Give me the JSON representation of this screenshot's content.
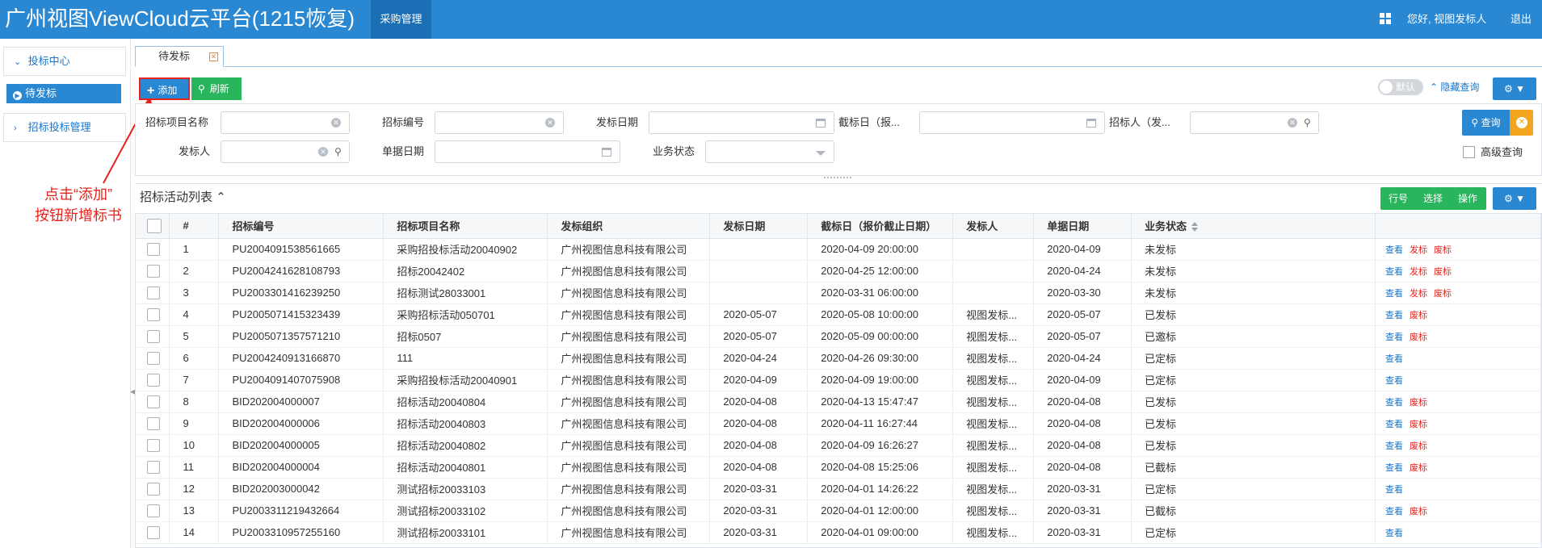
{
  "header": {
    "app_title": "广州视图ViewCloud云平台(1215恢复)",
    "module_tab": "采购管理",
    "greeting": "您好, 视图发标人",
    "logout": "退出"
  },
  "sidebar": {
    "groups": [
      {
        "label": "投标中心",
        "expanded": true
      },
      {
        "label": "招标投标管理",
        "expanded": false
      }
    ],
    "active_item": "待发标"
  },
  "annotation": {
    "line1": "点击“添加”",
    "line2": "按钮新增标书"
  },
  "tabs": [
    {
      "label": "待发标",
      "close": "✕"
    }
  ],
  "toolbar": {
    "add_label": "添加",
    "refresh_label": "刷新",
    "default_toggle": "默认",
    "hide_query": "隐藏查询"
  },
  "filters": {
    "project_name": "招标项目名称",
    "bid_no": "招标编号",
    "publish_date": "发标日期",
    "deadline": "截标日（报...",
    "bidder": "招标人（发...",
    "publisher": "发标人",
    "doc_date": "单据日期",
    "biz_status": "业务状态",
    "query_button": "查询",
    "advanced_query": "高级查询"
  },
  "list": {
    "title": "招标活动列表",
    "row_no_btn": "行号",
    "select_btn": "选择",
    "action_btn": "操作"
  },
  "table": {
    "columns": [
      "#",
      "招标编号",
      "招标项目名称",
      "发标组织",
      "发标日期",
      "截标日（报价截止日期）",
      "发标人",
      "单据日期",
      "业务状态"
    ],
    "rows": [
      {
        "no": "1",
        "code": "PU2004091538561665",
        "name": "采购招投标活动20040902",
        "org": "广州视图信息科技有限公司",
        "pub_date": "",
        "deadline": "2020-04-09 20:00:00",
        "publisher": "",
        "doc_date": "2020-04-09",
        "status": "未发标",
        "ops": [
          "查看",
          "发标",
          "废标"
        ]
      },
      {
        "no": "2",
        "code": "PU2004241628108793",
        "name": "招标20042402",
        "org": "广州视图信息科技有限公司",
        "pub_date": "",
        "deadline": "2020-04-25 12:00:00",
        "publisher": "",
        "doc_date": "2020-04-24",
        "status": "未发标",
        "ops": [
          "查看",
          "发标",
          "废标"
        ]
      },
      {
        "no": "3",
        "code": "PU2003301416239250",
        "name": "招标测试28033001",
        "org": "广州视图信息科技有限公司",
        "pub_date": "",
        "deadline": "2020-03-31 06:00:00",
        "publisher": "",
        "doc_date": "2020-03-30",
        "status": "未发标",
        "ops": [
          "查看",
          "发标",
          "废标"
        ]
      },
      {
        "no": "4",
        "code": "PU2005071415323439",
        "name": "采购招标活动050701",
        "org": "广州视图信息科技有限公司",
        "pub_date": "2020-05-07",
        "deadline": "2020-05-08 10:00:00",
        "publisher": "视图发标...",
        "doc_date": "2020-05-07",
        "status": "已发标",
        "ops": [
          "查看",
          "废标"
        ]
      },
      {
        "no": "5",
        "code": "PU2005071357571210",
        "name": "招标0507",
        "org": "广州视图信息科技有限公司",
        "pub_date": "2020-05-07",
        "deadline": "2020-05-09 00:00:00",
        "publisher": "视图发标...",
        "doc_date": "2020-05-07",
        "status": "已邀标",
        "ops": [
          "查看",
          "废标"
        ]
      },
      {
        "no": "6",
        "code": "PU2004240913166870",
        "name": "111",
        "org": "广州视图信息科技有限公司",
        "pub_date": "2020-04-24",
        "deadline": "2020-04-26 09:30:00",
        "publisher": "视图发标...",
        "doc_date": "2020-04-24",
        "status": "已定标",
        "ops": [
          "查看"
        ]
      },
      {
        "no": "7",
        "code": "PU2004091407075908",
        "name": "采购招投标活动20040901",
        "org": "广州视图信息科技有限公司",
        "pub_date": "2020-04-09",
        "deadline": "2020-04-09 19:00:00",
        "publisher": "视图发标...",
        "doc_date": "2020-04-09",
        "status": "已定标",
        "ops": [
          "查看"
        ]
      },
      {
        "no": "8",
        "code": "BID202004000007",
        "name": "招标活动20040804",
        "org": "广州视图信息科技有限公司",
        "pub_date": "2020-04-08",
        "deadline": "2020-04-13 15:47:47",
        "publisher": "视图发标...",
        "doc_date": "2020-04-08",
        "status": "已发标",
        "ops": [
          "查看",
          "废标"
        ]
      },
      {
        "no": "9",
        "code": "BID202004000006",
        "name": "招标活动20040803",
        "org": "广州视图信息科技有限公司",
        "pub_date": "2020-04-08",
        "deadline": "2020-04-11 16:27:44",
        "publisher": "视图发标...",
        "doc_date": "2020-04-08",
        "status": "已发标",
        "ops": [
          "查看",
          "废标"
        ]
      },
      {
        "no": "10",
        "code": "BID202004000005",
        "name": "招标活动20040802",
        "org": "广州视图信息科技有限公司",
        "pub_date": "2020-04-08",
        "deadline": "2020-04-09 16:26:27",
        "publisher": "视图发标...",
        "doc_date": "2020-04-08",
        "status": "已发标",
        "ops": [
          "查看",
          "废标"
        ]
      },
      {
        "no": "11",
        "code": "BID202004000004",
        "name": "招标活动20040801",
        "org": "广州视图信息科技有限公司",
        "pub_date": "2020-04-08",
        "deadline": "2020-04-08 15:25:06",
        "publisher": "视图发标...",
        "doc_date": "2020-04-08",
        "status": "已截标",
        "ops": [
          "查看",
          "废标"
        ]
      },
      {
        "no": "12",
        "code": "BID202003000042",
        "name": "测试招标20033103",
        "org": "广州视图信息科技有限公司",
        "pub_date": "2020-03-31",
        "deadline": "2020-04-01 14:26:22",
        "publisher": "视图发标...",
        "doc_date": "2020-03-31",
        "status": "已定标",
        "ops": [
          "查看"
        ]
      },
      {
        "no": "13",
        "code": "PU2003311219432664",
        "name": "测试招标20033102",
        "org": "广州视图信息科技有限公司",
        "pub_date": "2020-03-31",
        "deadline": "2020-04-01 12:00:00",
        "publisher": "视图发标...",
        "doc_date": "2020-03-31",
        "status": "已截标",
        "ops": [
          "查看",
          "废标"
        ]
      },
      {
        "no": "14",
        "code": "PU2003310957255160",
        "name": "测试招标20033101",
        "org": "广州视图信息科技有限公司",
        "pub_date": "2020-03-31",
        "deadline": "2020-04-01 09:00:00",
        "publisher": "视图发标...",
        "doc_date": "2020-03-31",
        "status": "已定标",
        "ops": [
          "查看"
        ]
      }
    ]
  },
  "colors": {
    "primary": "#2a87d1",
    "success": "#28b55b",
    "warning": "#f3a51f",
    "danger": "#e8231c",
    "link": "#1a75c9"
  }
}
